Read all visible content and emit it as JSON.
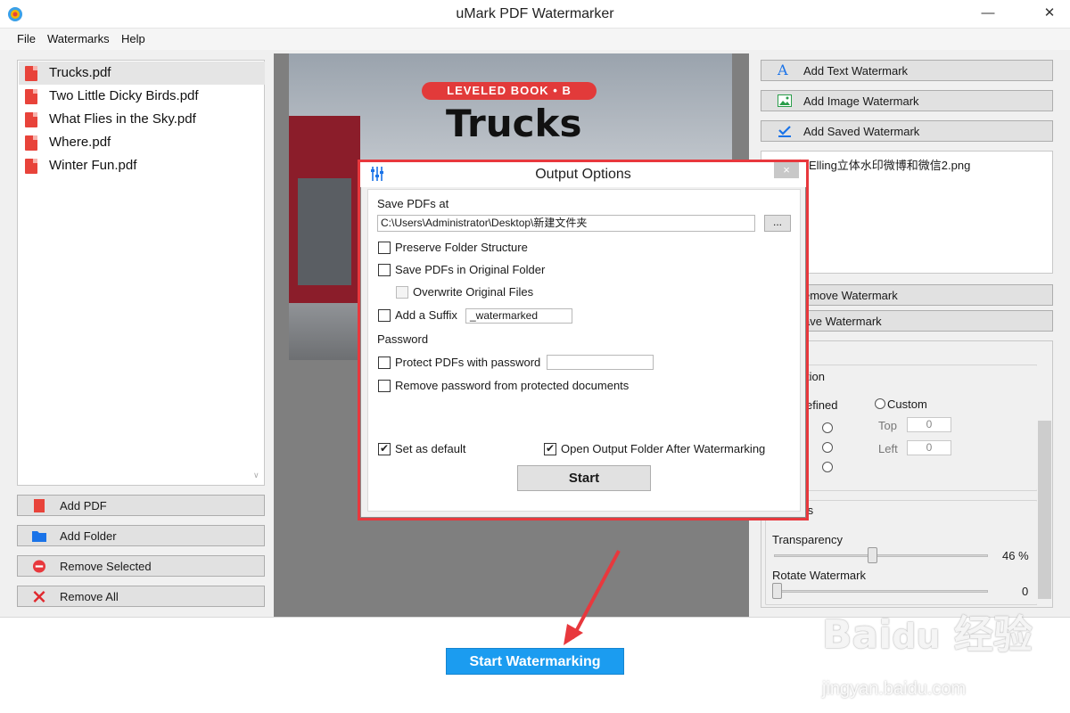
{
  "window": {
    "title": "uMark PDF Watermarker"
  },
  "menu": [
    "File",
    "Watermarks",
    "Help"
  ],
  "files": [
    {
      "name": "Trucks.pdf",
      "selected": true
    },
    {
      "name": "Two Little Dicky Birds.pdf",
      "selected": false
    },
    {
      "name": "What Flies in the Sky.pdf",
      "selected": false
    },
    {
      "name": "Where.pdf",
      "selected": false
    },
    {
      "name": "Winter Fun.pdf",
      "selected": false
    }
  ],
  "left_buttons": {
    "add_pdf": "Add PDF",
    "add_folder": "Add Folder",
    "remove_selected": "Remove Selected",
    "remove_all": "Remove All"
  },
  "preview": {
    "badge": "LEVELED BOOK • B",
    "title": "Trucks"
  },
  "right_buttons": {
    "add_text": "Add Text Watermark",
    "add_image": "Add Image Watermark",
    "add_saved": "Add Saved Watermark",
    "remove_wm": "emove Watermark",
    "save_wm": "ave Watermark"
  },
  "watermark_list": [
    "百经Elling立体水印微博和微信2.png"
  ],
  "properties": {
    "position_title": "tion",
    "predefined": "efined",
    "custom": "Custom",
    "top_label": "Top",
    "top_value": "0",
    "left_label": "Left",
    "left_value": "0",
    "effects_title": "ts",
    "transparency_label": "Transparency",
    "transparency_value": "46 %",
    "transparency_fraction": 0.46,
    "rotate_label": "Rotate Watermark",
    "rotate_value": "0"
  },
  "dialog": {
    "title": "Output Options",
    "close": "×",
    "save_at_label": "Save PDFs at",
    "path": "C:\\Users\\Administrator\\Desktop\\新建文件夹",
    "browse": "...",
    "preserve": "Preserve Folder Structure",
    "original_folder": "Save PDFs in Original Folder",
    "overwrite": "Overwrite Original Files",
    "add_suffix": "Add a Suffix",
    "suffix_value": "_watermarked",
    "password_section": "Password",
    "protect": "Protect PDFs with password",
    "remove_password": "Remove password from protected documents",
    "set_default": "Set as default",
    "open_output": "Open Output Folder After Watermarking",
    "start": "Start"
  },
  "start_main": "Start Watermarking",
  "site_watermark": {
    "logo": "Bai du 经验",
    "url": "jingyan.baidu.com"
  },
  "colors": {
    "accent": "#1b9cf0",
    "highlight": "#e8383d",
    "pdf_red": "#e8433a"
  }
}
